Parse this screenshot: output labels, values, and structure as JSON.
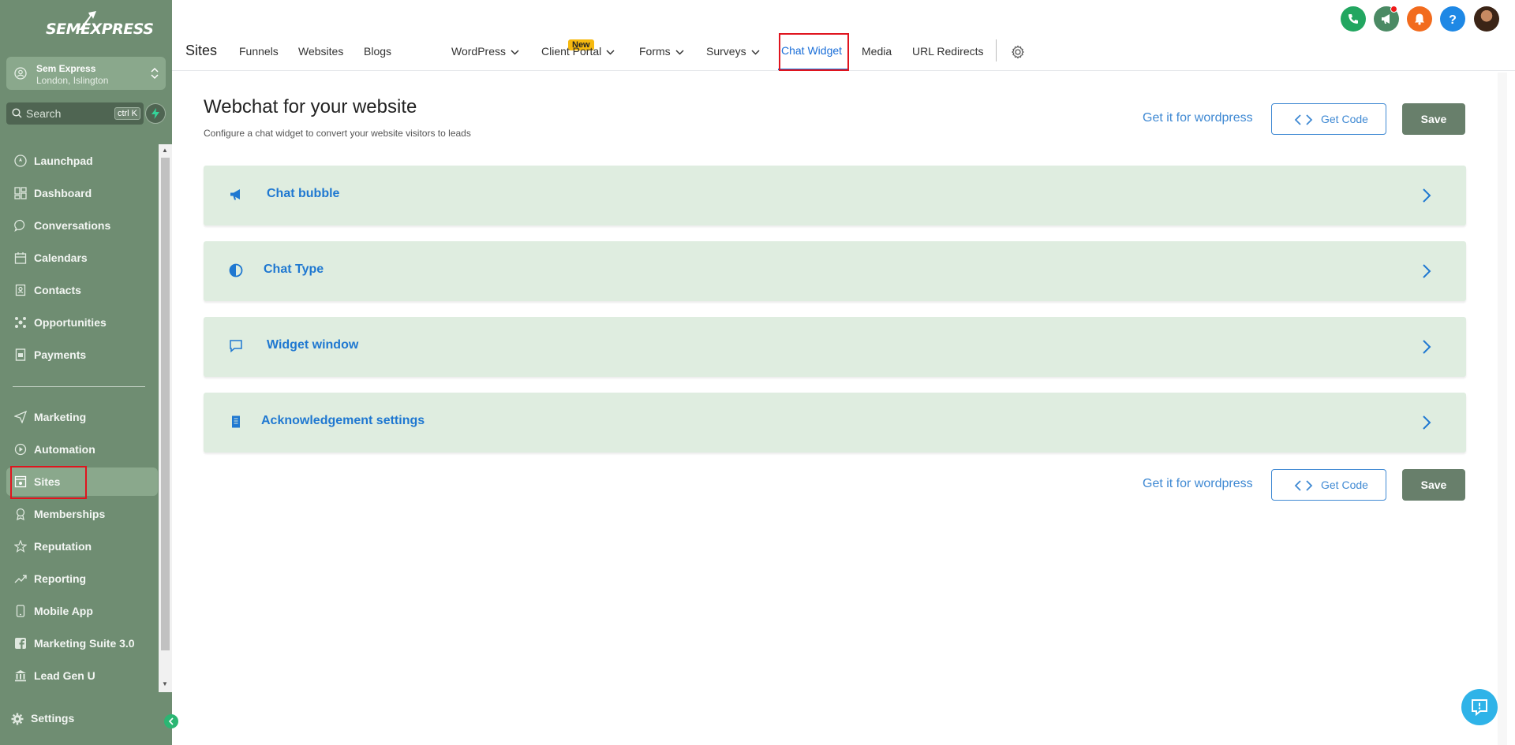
{
  "sidebar": {
    "logo": "SEMEXPRESS",
    "account": {
      "name": "Sem Express",
      "location": "London, Islington"
    },
    "search": {
      "placeholder": "Search",
      "shortcut": "ctrl K"
    },
    "items_top": [
      {
        "label": "Launchpad",
        "icon": "rocket-icon"
      },
      {
        "label": "Dashboard",
        "icon": "grid-icon"
      },
      {
        "label": "Conversations",
        "icon": "chat-icon"
      },
      {
        "label": "Calendars",
        "icon": "calendar-icon"
      },
      {
        "label": "Contacts",
        "icon": "contacts-icon"
      },
      {
        "label": "Opportunities",
        "icon": "gear-cluster-icon"
      },
      {
        "label": "Payments",
        "icon": "receipt-icon"
      }
    ],
    "items_bottom": [
      {
        "label": "Marketing",
        "icon": "send-icon"
      },
      {
        "label": "Automation",
        "icon": "automation-icon"
      },
      {
        "label": "Sites",
        "icon": "sites-icon",
        "active": true
      },
      {
        "label": "Memberships",
        "icon": "badge-icon"
      },
      {
        "label": "Reputation",
        "icon": "star-icon"
      },
      {
        "label": "Reporting",
        "icon": "trend-icon"
      },
      {
        "label": "Mobile App",
        "icon": "mobile-icon"
      },
      {
        "label": "Marketing Suite 3.0",
        "icon": "facebook-icon"
      },
      {
        "label": "Lead Gen U",
        "icon": "bank-icon"
      }
    ],
    "settings_label": "Settings"
  },
  "topnav": {
    "title": "Sites",
    "tabs": [
      "Funnels",
      "Websites",
      "Blogs",
      "WordPress",
      "Client Portal",
      "Forms",
      "Surveys",
      "Chat Widget",
      "Media",
      "URL Redirects"
    ],
    "new_badge": "New",
    "active_tab": "Chat Widget"
  },
  "main": {
    "title": "Webchat for your website",
    "subtitle": "Configure a chat widget to convert your website visitors to leads",
    "wordpress_link": "Get it for wordpress",
    "get_code_label": "Get Code",
    "save_label": "Save",
    "panels": [
      {
        "label": "Chat bubble",
        "icon": "megaphone-icon"
      },
      {
        "label": "Chat Type",
        "icon": "half-circle-icon"
      },
      {
        "label": "Widget window",
        "icon": "message-square-icon"
      },
      {
        "label": "Acknowledgement settings",
        "icon": "document-icon"
      }
    ]
  },
  "colors": {
    "sidebar_bg": "#6f8d72",
    "accent": "#1a6ed8",
    "panel_bg": "#dfede0",
    "save_bg": "#687f6b",
    "new_badge": "#f6b90f"
  }
}
